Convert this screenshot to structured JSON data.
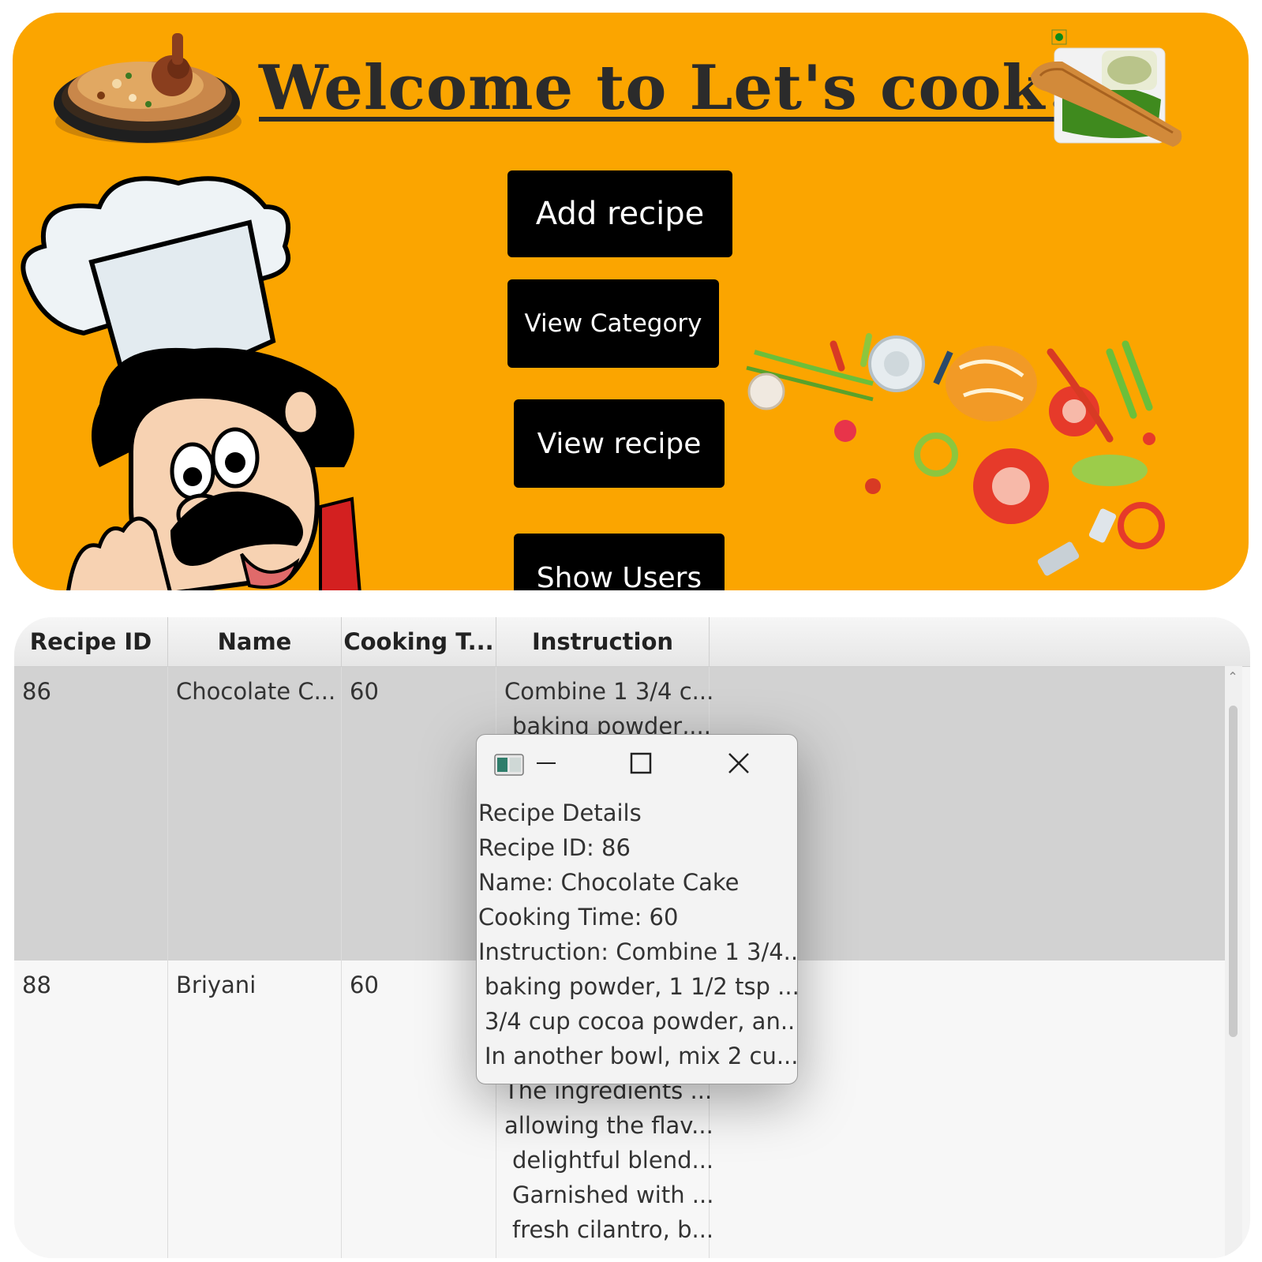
{
  "home": {
    "title": "Welcome to Let's cook!!",
    "buttons": {
      "add_recipe": "Add recipe",
      "view_category": "View Category",
      "view_recipe": "View recipe",
      "show_users": "Show Users"
    }
  },
  "table": {
    "columns": [
      "Recipe ID",
      "Name",
      "Cooking T...",
      "Instruction"
    ],
    "rows": [
      {
        "id": "86",
        "name": "Chocolate C...",
        "cooking_time": "60",
        "instruction_lines": [
          "Combine 1 3/4 c...",
          "baking powder,..."
        ],
        "selected": true
      },
      {
        "id": "88",
        "name": "Briyani",
        "cooking_time": "60",
        "instruction_lines": [
          "The ingredients ...",
          "allowing the flav...",
          "delightful blend...",
          "Garnished with ...",
          "fresh cilantro, b..."
        ],
        "selected": false
      }
    ]
  },
  "dialog": {
    "lines": [
      "Recipe Details",
      "Recipe ID: 86",
      "Name: Chocolate Cake",
      "Cooking Time: 60",
      "Instruction: Combine 1 3/4...",
      " baking powder, 1 1/2 tsp ...",
      " 3/4 cup cocoa powder, an...",
      " In another bowl, mix 2 cu..."
    ]
  },
  "colors": {
    "home_background": "#fba500",
    "button_background": "#000000",
    "selected_row": "#d2d2d2"
  },
  "icons": [
    "biryani-image",
    "dosa-image",
    "chef-image",
    "vegetables-image",
    "app-icon",
    "minimize-icon",
    "maximize-icon",
    "close-icon"
  ]
}
